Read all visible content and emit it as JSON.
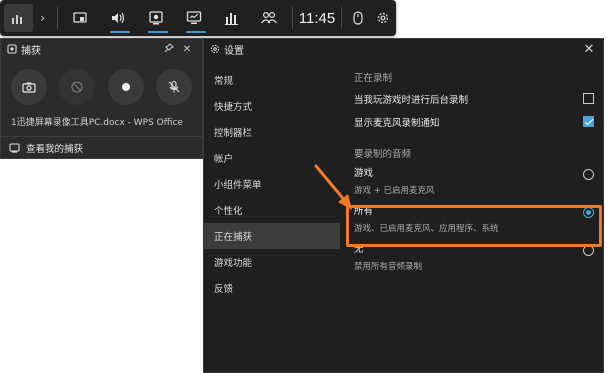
{
  "topbar": {
    "time": "11:45",
    "items": [
      {
        "name": "home-icon",
        "active": false
      },
      {
        "name": "widget-icon",
        "active": false
      },
      {
        "name": "audio-icon",
        "active": true
      },
      {
        "name": "capture-icon",
        "active": true
      },
      {
        "name": "performance-icon",
        "active": true
      },
      {
        "name": "resources-icon",
        "active": false
      },
      {
        "name": "social-icon",
        "active": false
      }
    ]
  },
  "capture": {
    "title": "捕获",
    "document_name": "1迅捷屏幕录像工具PC.docx - WPS Office",
    "footer_label": "查看我的捕获"
  },
  "settings": {
    "title": "设置",
    "nav": [
      {
        "label": "常规"
      },
      {
        "label": "快捷方式"
      },
      {
        "label": "控制器栏"
      },
      {
        "label": "帐户"
      },
      {
        "label": "小组件菜单"
      },
      {
        "label": "个性化"
      },
      {
        "label": "正在捕获",
        "active": true
      },
      {
        "label": "游戏功能"
      },
      {
        "label": "反馈"
      }
    ],
    "recording_section_title": "正在录制",
    "options": [
      {
        "label": "当我玩游戏时进行后台录制",
        "checked": false
      },
      {
        "label": "显示麦克风录制通知",
        "checked": true
      }
    ],
    "audio_section_title": "要录制的音频",
    "audio_options": [
      {
        "name": "游戏",
        "desc": "游戏 + 已启用麦克风",
        "selected": false
      },
      {
        "name": "所有",
        "desc": "游戏、已启用麦克风、应用程序、系统",
        "selected": true
      },
      {
        "name": "无",
        "desc": "禁用所有音频录制",
        "selected": false
      }
    ]
  },
  "colors": {
    "accent": "#4aa3d6",
    "highlight": "#f07a28",
    "panel_bg": "#1f1f1f"
  }
}
